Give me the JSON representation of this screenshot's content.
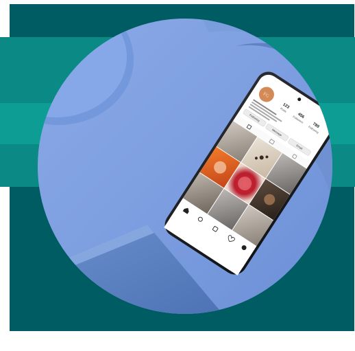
{
  "colors": {
    "frame_teal": "#005c63",
    "band_teal": "#0b8a85",
    "surface_blue": "#7b9fe0",
    "phone_body": "#1d1f24",
    "profile_avatar": "#d38a57"
  },
  "phone": {
    "profile": {
      "avatar_initials": "FG",
      "posts_count": "123",
      "posts_label": "Posts",
      "followers_count": "456",
      "followers_label": "Followers",
      "following_count": "789",
      "following_label": "Following",
      "button_follow": "Following",
      "button_message": "Message",
      "button_email": "Email"
    },
    "nav_icons": [
      "home-icon",
      "search-icon",
      "plus-icon",
      "heart-icon",
      "profile-icon"
    ]
  }
}
